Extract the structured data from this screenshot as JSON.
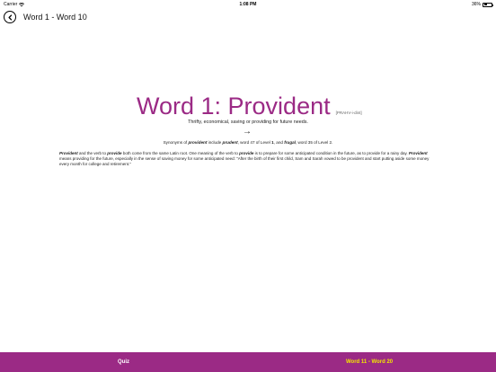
{
  "status_bar": {
    "carrier": "Carrier",
    "time": "1:08 PM",
    "battery": "36%",
    "battery_level": 0.36
  },
  "nav": {
    "title": "Word 1 - Word 10"
  },
  "word": {
    "title": "Word 1: Provident",
    "pronunciation": "[PRAHV-i-dint]",
    "definition": "Thrifty, economical, saving or providing for future needs.",
    "arrow": "→"
  },
  "synonyms": {
    "pre": "Synonyms of ",
    "w1": "provident",
    "mid1": " include ",
    "w2": "prudent",
    "mid2": ", word 47 of Level ",
    "lvl1": "1",
    "mid3": ", and ",
    "w3": "frugal",
    "post": ", word 35 of Level 2."
  },
  "paragraph": {
    "s1": "Provident",
    "s2": " and the verb to ",
    "s3": "provide",
    "s4": " both come from the same Latin root. One meaning of the verb to ",
    "s5": "provide",
    "s6": " is to prepare for some anticipated condition in the future, as to provide for a rainy day. ",
    "s7": "Provident",
    "s8": " means providing for the future, especially in the sense of saving money for some anticipated need: \"After the birth of their first child, Sam and Sarah vowed to be provident and start putting aside some money every month for college and retirement.\""
  },
  "tabs": {
    "quiz": "Quiz",
    "next": "Word 11 - Word 20"
  },
  "colors": {
    "accent": "#9b2a85",
    "next_tab_text": "#f2e600"
  }
}
